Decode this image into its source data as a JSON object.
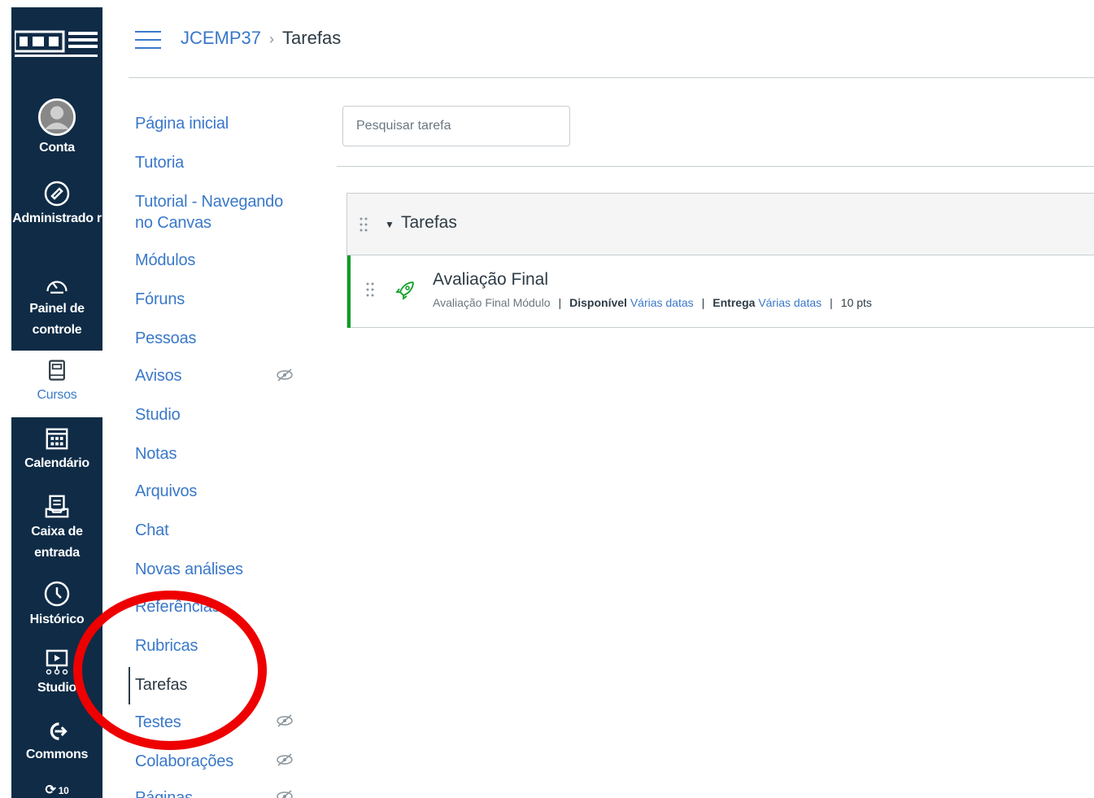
{
  "global_nav": {
    "items": [
      {
        "label": "Conta",
        "icon": "user-avatar-icon"
      },
      {
        "label": "Administrado r",
        "icon": "admin-shield-icon"
      },
      {
        "label": "Painel de controle",
        "icon": "dashboard-icon"
      },
      {
        "label": "Cursos",
        "icon": "courses-book-icon"
      },
      {
        "label": "Calendário",
        "icon": "calendar-icon"
      },
      {
        "label": "Caixa de entrada",
        "icon": "inbox-icon"
      },
      {
        "label": "Histórico",
        "icon": "clock-icon"
      },
      {
        "label": "Studio",
        "icon": "studio-icon"
      },
      {
        "label": "Commons",
        "icon": "commons-icon"
      },
      {
        "label": "10",
        "icon": "badge-icon"
      }
    ]
  },
  "header": {
    "course": "JCEMP37",
    "separator": "›",
    "current": "Tarefas"
  },
  "course_nav": {
    "items": [
      {
        "label": "Página inicial"
      },
      {
        "label": "Tutoria"
      },
      {
        "label": "Tutorial - Navegando no Canvas"
      },
      {
        "label": "Módulos"
      },
      {
        "label": "Fóruns"
      },
      {
        "label": "Pessoas"
      },
      {
        "label": "Avisos",
        "hidden": true
      },
      {
        "label": "Studio"
      },
      {
        "label": "Notas"
      },
      {
        "label": "Arquivos"
      },
      {
        "label": "Chat"
      },
      {
        "label": "Novas análises"
      },
      {
        "label": "Referências"
      },
      {
        "label": "Rubricas"
      },
      {
        "label": "Tarefas",
        "current": true
      },
      {
        "label": "Testes",
        "hidden": true
      },
      {
        "label": "Colaborações",
        "hidden": true
      },
      {
        "label": "Páginas",
        "hidden": true
      }
    ]
  },
  "search": {
    "placeholder": "Pesquisar tarefa"
  },
  "assignment_group": {
    "title": "Tarefas",
    "assignments": [
      {
        "title": "Avaliação Final",
        "module": "Avaliação Final Módulo",
        "available_label": "Disponível",
        "available_value": "Várias datas",
        "due_label": "Entrega",
        "due_value": "Várias datas",
        "points": "10 pts",
        "status_color": "#0b9e24"
      }
    ]
  },
  "colors": {
    "link": "#3a78c9",
    "nav_bg": "#0f2b46",
    "annotation": "#ee0000"
  }
}
